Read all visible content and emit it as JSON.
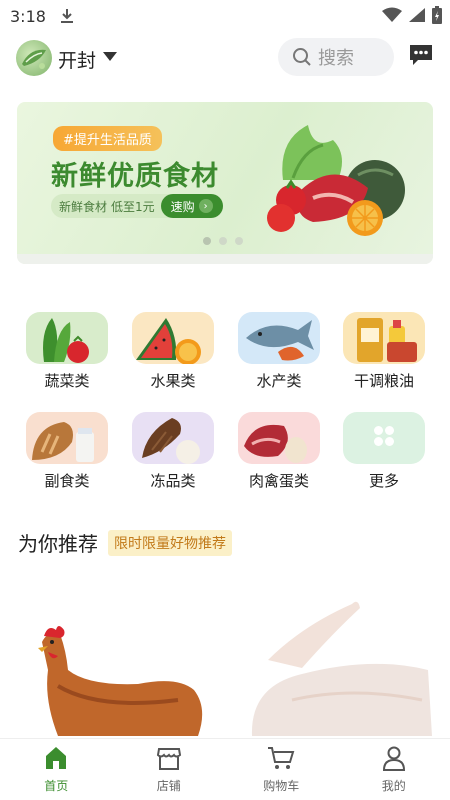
{
  "status_bar": {
    "time": "3:18"
  },
  "header": {
    "city": "开封",
    "search_placeholder": "搜索",
    "message_icon": "chat-bubble-icon"
  },
  "banner": {
    "tag": "#提升生活品质",
    "title": "新鲜优质食材",
    "subtitle_label": "新鲜食材",
    "subtitle_price": "低至1元",
    "buy_label": "速购",
    "slide_count": 3,
    "active_slide": 1
  },
  "categories": [
    {
      "label": "蔬菜类",
      "icon": "vegetable-icon",
      "color": "#d8eccb"
    },
    {
      "label": "水果类",
      "icon": "fruit-icon",
      "color": "#fbe7c2"
    },
    {
      "label": "水产类",
      "icon": "seafood-icon",
      "color": "#d4e8f8"
    },
    {
      "label": "干调粮油",
      "icon": "grain-oil-icon",
      "color": "#fbe6b6"
    },
    {
      "label": "副食类",
      "icon": "bread-milk-icon",
      "color": "#f9dfcf"
    },
    {
      "label": "冻品类",
      "icon": "icecream-icon",
      "color": "#e8e0f4"
    },
    {
      "label": "肉禽蛋类",
      "icon": "meat-egg-icon",
      "color": "#fadada"
    },
    {
      "label": "更多",
      "icon": "more-clover-icon",
      "color": "#dcf2e2"
    }
  ],
  "recommend": {
    "title": "为你推荐",
    "badge": "限时限量好物推荐"
  },
  "tabbar": [
    {
      "label": "首页",
      "icon": "home-icon",
      "active": true
    },
    {
      "label": "店铺",
      "icon": "store-icon",
      "active": false
    },
    {
      "label": "购物车",
      "icon": "cart-icon",
      "active": false
    },
    {
      "label": "我的",
      "icon": "user-icon",
      "active": false
    }
  ],
  "colors": {
    "brand_green": "#3b8d2e",
    "badge_bg": "#fbf0c8",
    "badge_text": "#c27a1a"
  }
}
